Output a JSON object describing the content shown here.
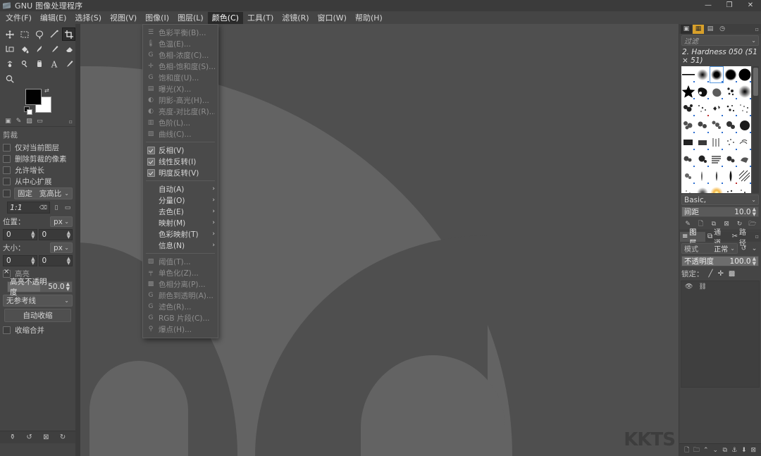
{
  "window": {
    "title": "GNU 图像处理程序",
    "icon": "gimp-wilber-icon",
    "controls": {
      "minimize": "—",
      "maximize": "❐",
      "close": "✕"
    }
  },
  "menubar": {
    "items": [
      {
        "label": "文件(F)",
        "active": false
      },
      {
        "label": "编辑(E)",
        "active": false
      },
      {
        "label": "选择(S)",
        "active": false
      },
      {
        "label": "视图(V)",
        "active": false
      },
      {
        "label": "图像(I)",
        "active": false
      },
      {
        "label": "图层(L)",
        "active": false
      },
      {
        "label": "颜色(C)",
        "active": true
      },
      {
        "label": "工具(T)",
        "active": false
      },
      {
        "label": "滤镜(R)",
        "active": false
      },
      {
        "label": "窗口(W)",
        "active": false
      },
      {
        "label": "帮助(H)",
        "active": false
      }
    ]
  },
  "colors_menu": {
    "owner": "颜色(C)",
    "groups": [
      {
        "items": [
          {
            "label": "色彩平衡(B)...",
            "icon": "balance-icon",
            "disabled": true,
            "type": "item"
          },
          {
            "label": "色温(E)...",
            "icon": "temperature-icon",
            "disabled": true,
            "type": "item"
          },
          {
            "label": "色相-浓度(C)...",
            "icon": "hue-chroma-icon",
            "disabled": true,
            "type": "item"
          },
          {
            "label": "色相-饱和度(S)...",
            "icon": "hue-saturation-icon",
            "disabled": true,
            "type": "item"
          },
          {
            "label": "饱和度(U)...",
            "icon": "saturation-icon",
            "disabled": true,
            "type": "item"
          },
          {
            "label": "曝光(X)...",
            "icon": "exposure-icon",
            "disabled": true,
            "type": "item"
          },
          {
            "label": "阴影-高光(H)...",
            "icon": "shadows-highlights-icon",
            "disabled": true,
            "type": "item"
          },
          {
            "label": "亮度-对比度(R)...",
            "icon": "brightness-contrast-icon",
            "disabled": true,
            "type": "item"
          },
          {
            "label": "色阶(L)...",
            "icon": "levels-icon",
            "disabled": true,
            "type": "item"
          },
          {
            "label": "曲线(C)...",
            "icon": "curves-icon",
            "disabled": true,
            "type": "item"
          }
        ]
      },
      {
        "items": [
          {
            "label": "反相(V)",
            "icon": "invert-icon",
            "disabled": false,
            "type": "check"
          },
          {
            "label": "线性反转(I)",
            "icon": "linear-invert-icon",
            "disabled": false,
            "type": "check"
          },
          {
            "label": "明度反转(V)",
            "icon": "value-invert-icon",
            "disabled": false,
            "type": "check"
          }
        ]
      },
      {
        "items": [
          {
            "label": "自动(A)",
            "icon": "",
            "disabled": false,
            "type": "submenu",
            "arrow": "›"
          },
          {
            "label": "分量(O)",
            "icon": "",
            "disabled": false,
            "type": "submenu",
            "arrow": "›"
          },
          {
            "label": "去色(E)",
            "icon": "",
            "disabled": false,
            "type": "submenu",
            "arrow": "›"
          },
          {
            "label": "映射(M)",
            "icon": "",
            "disabled": false,
            "type": "submenu",
            "arrow": "›"
          },
          {
            "label": "色彩映射(T)",
            "icon": "",
            "disabled": false,
            "type": "submenu",
            "arrow": "›"
          },
          {
            "label": "信息(N)",
            "icon": "",
            "disabled": false,
            "type": "submenu",
            "arrow": "›"
          }
        ]
      },
      {
        "items": [
          {
            "label": "阈值(T)...",
            "icon": "threshold-icon",
            "disabled": true,
            "type": "item"
          },
          {
            "label": "单色化(Z)...",
            "icon": "monochrome-icon",
            "disabled": true,
            "type": "item"
          },
          {
            "label": "色相分离(P)...",
            "icon": "posterize-icon",
            "disabled": true,
            "type": "item"
          },
          {
            "label": "颜色到透明(A)...",
            "icon": "color-to-alpha-icon",
            "disabled": true,
            "type": "item"
          },
          {
            "label": "滤色(R)...",
            "icon": "dither-icon",
            "disabled": true,
            "type": "item"
          },
          {
            "label": "RGB 片段(C)...",
            "icon": "rgb-clip-icon",
            "disabled": true,
            "type": "item"
          },
          {
            "label": "爆点(H)...",
            "icon": "hot-icon",
            "disabled": true,
            "type": "item"
          }
        ]
      }
    ]
  },
  "toolbox": {
    "tools": [
      {
        "name": "move-tool",
        "selected": false
      },
      {
        "name": "rect-select-tool",
        "selected": false
      },
      {
        "name": "free-select-tool",
        "selected": false
      },
      {
        "name": "measure-tool",
        "selected": false
      },
      {
        "name": "crop-tool",
        "selected": true
      },
      {
        "name": "transform-tool",
        "selected": false
      },
      {
        "name": "bucket-fill-tool",
        "selected": false
      },
      {
        "name": "smudge-tool",
        "selected": false
      },
      {
        "name": "paintbrush-tool",
        "selected": false
      },
      {
        "name": "eraser-tool",
        "selected": false
      },
      {
        "name": "airbrush-tool",
        "selected": false
      },
      {
        "name": "clone-tool",
        "selected": false
      },
      {
        "name": "heal-tool",
        "selected": false
      },
      {
        "name": "text-tool",
        "selected": false
      },
      {
        "name": "color-picker-tool",
        "selected": false
      },
      {
        "name": "zoom-tool",
        "selected": false
      }
    ],
    "colors": {
      "foreground": "#000000",
      "background": "#ffffff"
    },
    "footer_icons": [
      "image-icon",
      "brush-icon",
      "pattern-icon",
      "gradient-icon"
    ]
  },
  "tool_options": {
    "title": "剪裁",
    "checkboxes": [
      {
        "label": "仅对当前图层",
        "checked": false
      },
      {
        "label": "删除剪裁的像素",
        "checked": false
      },
      {
        "label": "允许增长",
        "checked": false
      },
      {
        "label": "从中心扩展",
        "checked": false
      }
    ],
    "fixed": {
      "checked": false,
      "label": "固定",
      "value": "宽高比",
      "chevron": "⌄"
    },
    "ratio": {
      "value": "1:1",
      "clear_icon": "clear-icon",
      "portrait_icon": "portrait-icon",
      "landscape_icon": "landscape-icon"
    },
    "position": {
      "label": "位置：",
      "unit": "px",
      "x": "0",
      "y": "0"
    },
    "size": {
      "label": "大小：",
      "unit": "px",
      "w": "0",
      "h": "0"
    },
    "highlight": {
      "label": "高亮",
      "checked": true
    },
    "highlight_opacity": {
      "label": "高亮不透明度",
      "value": "50.0",
      "percent": 50
    },
    "guides": {
      "value": "无参考线",
      "chevron": "⌄"
    },
    "auto_shrink_button": "自动收缩",
    "shrink_merged": {
      "label": "收缩合并",
      "checked": false
    }
  },
  "toolbox_footer_buttons": [
    "restore-icon",
    "undo-icon",
    "reset-icon",
    "redo-icon"
  ],
  "canvas": {
    "background_color": "#4f4f4f",
    "shape_color": "#636363",
    "watermark": "KKTS"
  },
  "brushes_dock": {
    "tabs": [
      {
        "name": "brushes-tab",
        "icon": "▣",
        "state": "selected"
      },
      {
        "name": "patterns-tab",
        "icon": "▦",
        "state": "highlight"
      },
      {
        "name": "gradients-tab",
        "icon": "▤",
        "state": ""
      },
      {
        "name": "history-tab",
        "icon": "◷",
        "state": ""
      }
    ],
    "menu_icon": "dock-menu-icon",
    "search_placeholder": "过滤",
    "current_brush": "2. Hardness 050 (51 × 51)",
    "tag_value": "Basic,",
    "spacing": {
      "label": "间距",
      "value": "10.0",
      "percent": 10
    },
    "action_icons": [
      "edit-brush-icon",
      "new-brush-icon",
      "duplicate-brush-icon",
      "delete-brush-icon",
      "refresh-brush-icon",
      "open-folder-icon"
    ]
  },
  "layers_dock": {
    "tabs": [
      {
        "label": "图层",
        "icon": "≡",
        "active": true
      },
      {
        "label": "通道",
        "icon": "⧉",
        "active": false
      },
      {
        "label": "路径",
        "icon": "✂",
        "active": false
      }
    ],
    "menu_icon": "dock-menu-icon",
    "mode": {
      "label": "模式",
      "value": "正常",
      "chevron": "⌄"
    },
    "extra_icons": [
      "link-icon",
      "chevron-down-icon"
    ],
    "opacity": {
      "label": "不透明度",
      "value": "100.0",
      "percent": 100
    },
    "lock": {
      "label": "锁定：",
      "icons": [
        "lock-pixels-icon",
        "lock-position-icon",
        "lock-alpha-icon"
      ]
    },
    "list_header_icons": [
      "eye-icon",
      "chain-icon"
    ],
    "bottom_icons": [
      "new-layer-icon",
      "new-group-icon",
      "raise-layer-icon",
      "lower-layer-icon",
      "duplicate-layer-icon",
      "anchor-layer-icon",
      "merge-down-icon",
      "delete-layer-icon"
    ]
  }
}
